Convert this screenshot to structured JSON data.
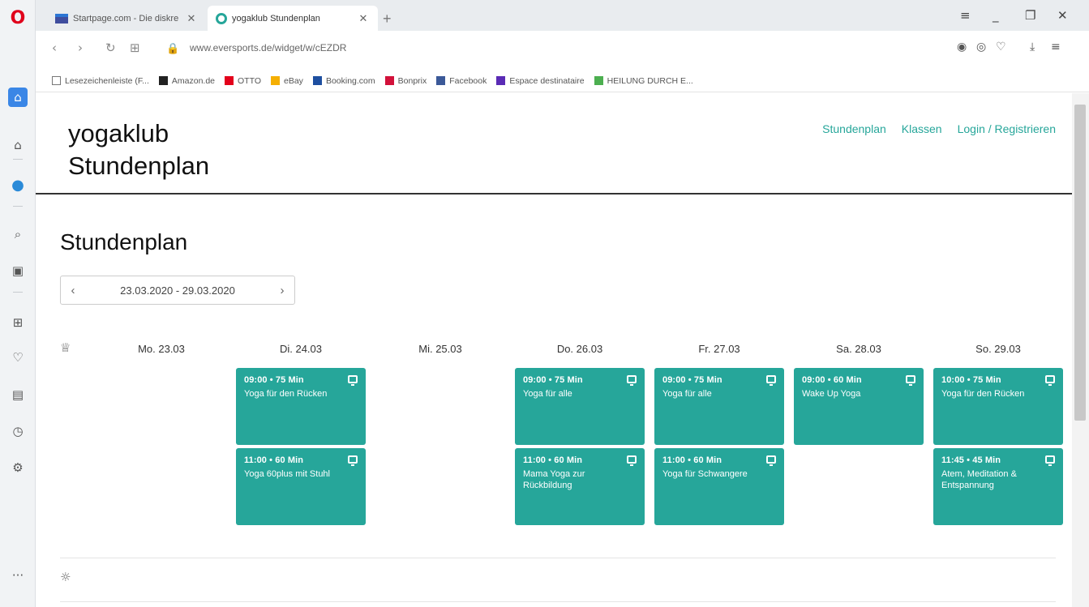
{
  "browser": {
    "tabs": [
      {
        "title": "Startpage.com - Die diskre",
        "active": false
      },
      {
        "title": "yogaklub Stundenplan",
        "active": true
      }
    ],
    "url": "www.eversports.de/widget/w/cEZDR",
    "bookmarks": [
      {
        "label": "Lesezeichenleiste (F...",
        "icon": "folder-icon",
        "color": "#777777"
      },
      {
        "label": "Amazon.de",
        "icon": "amazon-icon",
        "color": "#222222"
      },
      {
        "label": "OTTO",
        "icon": "otto-icon",
        "color": "#e3001b"
      },
      {
        "label": "eBay",
        "icon": "ebay-icon",
        "color": "#f5af02"
      },
      {
        "label": "Booking.com",
        "icon": "booking-icon",
        "color": "#1e4fa0"
      },
      {
        "label": "Bonprix",
        "icon": "bonprix-icon",
        "color": "#d2113a"
      },
      {
        "label": "Facebook",
        "icon": "facebook-icon",
        "color": "#3b5998"
      },
      {
        "label": "Espace destinataire",
        "icon": "espace-icon",
        "color": "#5a2bb5"
      },
      {
        "label": "HEILUNG DURCH E...",
        "icon": "check-circle-icon",
        "color": "#4caf50"
      }
    ]
  },
  "site": {
    "brand_line1": "yogaklub",
    "brand_line2": "Stundenplan",
    "nav": [
      "Stundenplan",
      "Klassen",
      "Login / Registrieren"
    ]
  },
  "schedule": {
    "title": "Stundenplan",
    "date_range": "23.03.2020 - 29.03.2020",
    "accent": "#26a69a",
    "days": [
      {
        "label": "Mo. 23.03",
        "classes": []
      },
      {
        "label": "Di. 24.03",
        "classes": [
          {
            "time": "09:00 • 75 Min",
            "name": "Yoga für den Rücken"
          },
          {
            "time": "11:00 • 60 Min",
            "name": "Yoga 60plus mit Stuhl"
          }
        ]
      },
      {
        "label": "Mi. 25.03",
        "classes": []
      },
      {
        "label": "Do. 26.03",
        "classes": [
          {
            "time": "09:00 • 75 Min",
            "name": "Yoga für alle"
          },
          {
            "time": "11:00 • 60 Min",
            "name": "Mama Yoga zur Rückbildung"
          }
        ]
      },
      {
        "label": "Fr. 27.03",
        "classes": [
          {
            "time": "09:00 • 75 Min",
            "name": "Yoga für alle"
          },
          {
            "time": "11:00 • 60 Min",
            "name": "Yoga für Schwangere"
          }
        ]
      },
      {
        "label": "Sa. 28.03",
        "classes": [
          {
            "time": "09:00 • 60 Min",
            "name": "Wake Up Yoga"
          }
        ]
      },
      {
        "label": "So. 29.03",
        "classes": [
          {
            "time": "10:00 • 75 Min",
            "name": "Yoga für den Rücken"
          },
          {
            "time": "11:45 • 45 Min",
            "name": "Atem, Meditation & Entspannung"
          }
        ]
      }
    ]
  }
}
